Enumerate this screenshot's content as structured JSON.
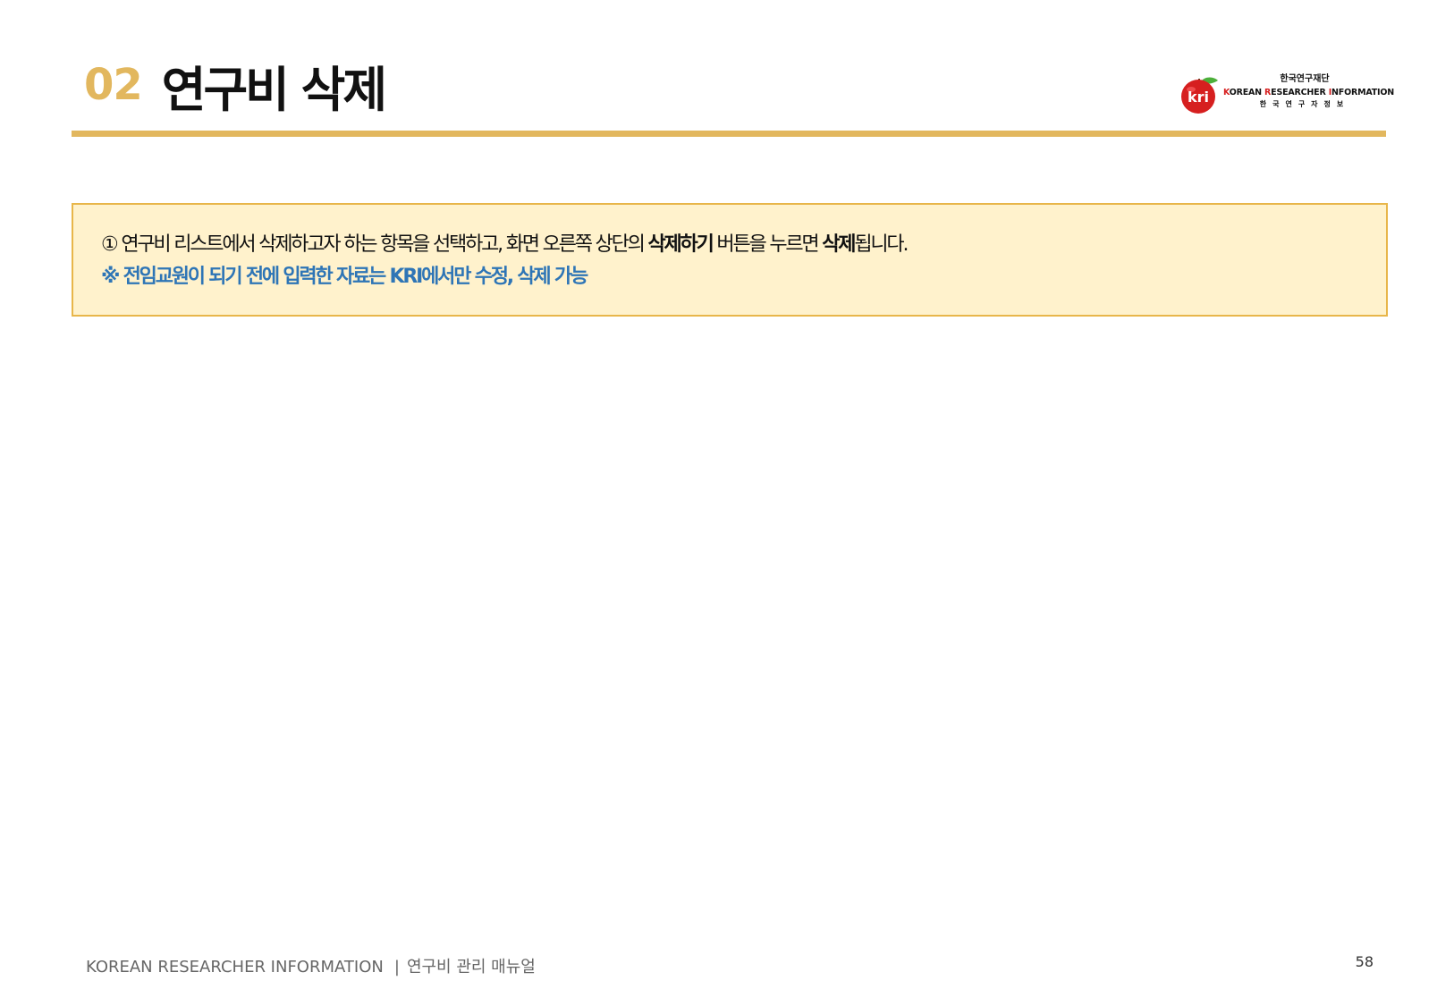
{
  "header": {
    "section_number": "02",
    "title": "연구비 삭제"
  },
  "logo": {
    "badge_text": "kri",
    "org_name_kr": "한국연구재단",
    "org_name_en_parts": [
      "K",
      "OREAN ",
      "R",
      "ESEARCHER ",
      "I",
      "NFORMATION"
    ],
    "sub_text": "한국연구자정보",
    "colors": {
      "apple": "#d61f1f",
      "leaf": "#4caf3a",
      "accent_letters": "#d61f1f"
    }
  },
  "notice": {
    "line1": {
      "t1": "① 연구비 리스트에서 삭제하고자 하는 항목을 선택하고, 화면 오른쪽 상단의 ",
      "b1": "삭제하기",
      "t2": " 버튼을 누르면 ",
      "b2": "삭제",
      "t3": "됩니다."
    },
    "line2": "※ 전임교원이 되기 전에 입력한 자료는 KRI에서만 수정, 삭제 가능"
  },
  "footer": {
    "left": "KOREAN RESEARCHER INFORMATION",
    "separator": "|",
    "manual": "연구비 관리 매뉴얼",
    "page_number": "58"
  },
  "colors": {
    "accent_gold": "#e2b75e",
    "notice_bg": "#fff2cc",
    "notice_border": "#e8b64a",
    "notice_blue": "#2e75b6"
  }
}
